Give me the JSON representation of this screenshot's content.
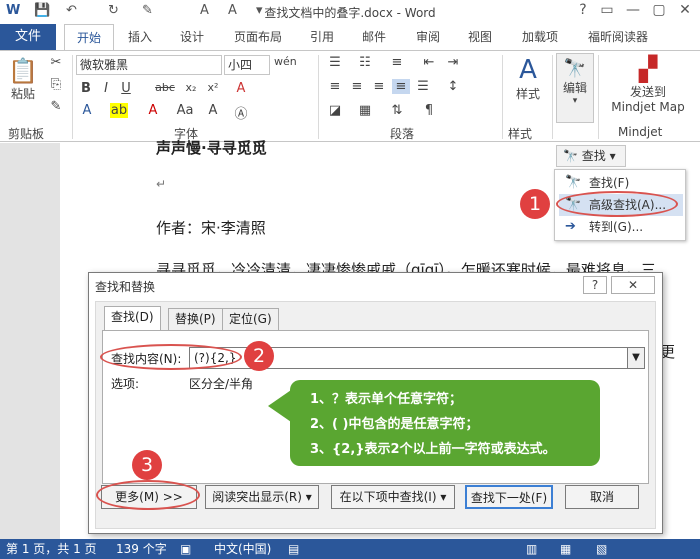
{
  "window": {
    "title": "查找文档中的叠字.docx - Word",
    "controls": [
      "?",
      "▭",
      "—",
      "▢",
      "✕"
    ]
  },
  "tabs": [
    "文件",
    "开始",
    "插入",
    "设计",
    "页面布局",
    "引用",
    "邮件",
    "审阅",
    "视图",
    "加载项",
    "福昕阅读器"
  ],
  "ribbon": {
    "clipboard": {
      "paste": "粘贴",
      "label": "剪贴板"
    },
    "font": {
      "name": "微软雅黑",
      "size": "小四",
      "label": "字体"
    },
    "paragraph": {
      "label": "段落"
    },
    "styles": {
      "button": "样式",
      "label": "样式"
    },
    "editing": {
      "button": "编辑"
    },
    "mindjet": {
      "button_line1": "发送到",
      "button_line2": "Mindjet Map",
      "label": "Mindjet"
    }
  },
  "document": {
    "line1": "声声慢·寻寻觅觅",
    "author": "作者：宋·李清照",
    "line3": "寻寻觅觅，冷冷清清，凄凄惨惨戚戚（qīqī）。乍暖还寒时候，最难将息。三",
    "right_fragment": "更"
  },
  "find_menu": {
    "split_label": "查找",
    "items": [
      "查找(F)",
      "高级查找(A)...",
      "转到(G)..."
    ]
  },
  "dialog": {
    "title": "查找和替换",
    "tabs": [
      "查找(D)",
      "替换(P)",
      "定位(G)"
    ],
    "find_label": "查找内容(N):",
    "find_value": "(?){2,}",
    "options_label": "选项:",
    "options_value": "区分全/半角",
    "buttons": {
      "more": "更多(M) >>",
      "highlight": "阅读突出显示(R) ▾",
      "find_in": "在以下项中查找(I) ▾",
      "find_next": "查找下一处(F)",
      "cancel": "取消"
    }
  },
  "callout": {
    "lines": [
      "1、？表示单个任意字符；",
      "2、( )中包含的是任意字符；",
      "3、{2,}表示2个以上前一字符或表达式。"
    ]
  },
  "annotations": [
    "1",
    "2",
    "3"
  ],
  "statusbar": {
    "page": "第 1 页，共 1 页",
    "words": "139 个字",
    "lang": "中文(中国)"
  },
  "colors": {
    "accent": "#2b579a",
    "callout": "#5aa631",
    "annotation": "#e04040"
  }
}
